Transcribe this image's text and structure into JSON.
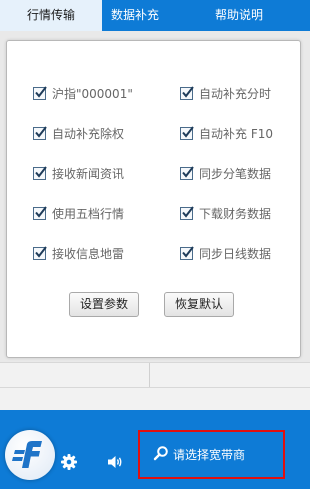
{
  "tabs": [
    {
      "label": "行情传输",
      "active": true
    },
    {
      "label": "数据补充",
      "active": false
    },
    {
      "label": "帮助说明",
      "active": false
    }
  ],
  "options": [
    {
      "label": "沪指\"000001\"",
      "checked": true
    },
    {
      "label": "自动补充分时",
      "checked": true
    },
    {
      "label": "自动补充除权",
      "checked": true
    },
    {
      "label": "自动补充 F10",
      "checked": true
    },
    {
      "label": "接收新闻资讯",
      "checked": true
    },
    {
      "label": "同步分笔数据",
      "checked": true
    },
    {
      "label": "使用五档行情",
      "checked": true
    },
    {
      "label": "下载财务数据",
      "checked": true
    },
    {
      "label": "接收信息地雷",
      "checked": true
    },
    {
      "label": "同步日线数据",
      "checked": true
    }
  ],
  "buttons": {
    "settings": "设置参数",
    "restore": "恢复默认"
  },
  "footer": {
    "broker_label": "请选择宽带商",
    "icons": [
      "logo-icon",
      "gear-icon",
      "speaker-icon",
      "search-icon"
    ]
  },
  "colors": {
    "accent": "#0e7bd6",
    "active_tab_bg": "#e6f1fb",
    "highlight_border": "#e01010"
  }
}
